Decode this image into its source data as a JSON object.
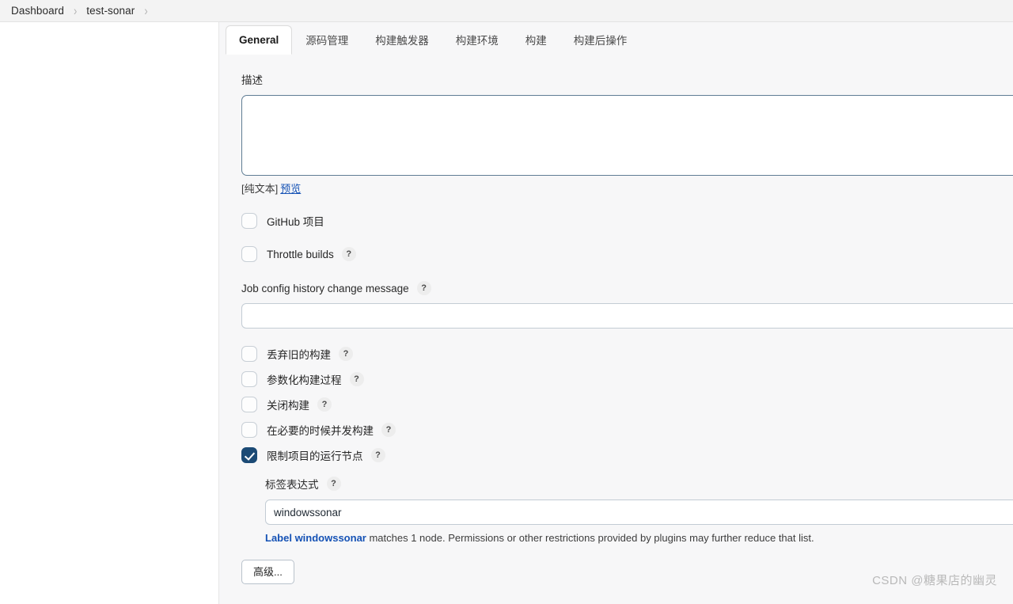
{
  "breadcrumb": {
    "items": [
      {
        "label": "Dashboard"
      },
      {
        "label": "test-sonar"
      }
    ],
    "separator": "›"
  },
  "tabs": [
    {
      "label": "General",
      "active": true
    },
    {
      "label": "源码管理",
      "active": false
    },
    {
      "label": "构建触发器",
      "active": false
    },
    {
      "label": "构建环境",
      "active": false
    },
    {
      "label": "构建",
      "active": false
    },
    {
      "label": "构建后操作",
      "active": false
    }
  ],
  "form": {
    "description": {
      "label": "描述",
      "value": "",
      "plain_text_note": "[纯文本]",
      "preview_link": "预览"
    },
    "github_project": {
      "label": "GitHub 项目",
      "checked": false
    },
    "throttle_builds": {
      "label": "Throttle builds",
      "checked": false,
      "help": "?"
    },
    "job_config_history": {
      "label": "Job config history change message",
      "help": "?",
      "value": ""
    },
    "options": [
      {
        "label": "丢弃旧的构建",
        "checked": false,
        "help": "?"
      },
      {
        "label": "参数化构建过程",
        "checked": false,
        "help": "?"
      },
      {
        "label": "关闭构建",
        "checked": false,
        "help": "?"
      },
      {
        "label": "在必要的时候并发构建",
        "checked": false,
        "help": "?"
      },
      {
        "label": "限制项目的运行节点",
        "checked": true,
        "help": "?"
      }
    ],
    "label_expression": {
      "label": "标签表达式",
      "help": "?",
      "value": "windowssonar",
      "note_link": "Label windowssonar",
      "note_rest": " matches 1 node. Permissions or other restrictions provided by plugins may further reduce that list."
    },
    "advanced_button": "高级..."
  },
  "watermark": "CSDN @糖果店的幽灵",
  "colors": {
    "accent_link": "#1552b5",
    "checkbox_checked": "#1b4a75",
    "content_bg": "#f7f7f8",
    "breadcrumb_bg": "#f3f3f3"
  }
}
